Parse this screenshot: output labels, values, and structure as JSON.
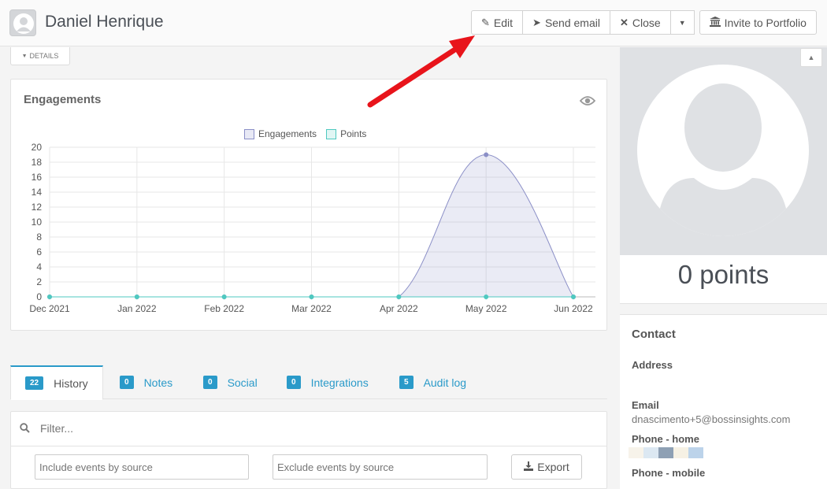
{
  "header": {
    "title": "Daniel Henrique",
    "buttons": {
      "edit": "Edit",
      "send_email": "Send email",
      "close": "Close",
      "invite": "Invite to Portfolio"
    }
  },
  "details_toggle": "DETAILS",
  "engagements": {
    "title": "Engagements",
    "legend": [
      "Engagements",
      "Points"
    ]
  },
  "chart_data": {
    "type": "area",
    "title": "Engagements",
    "x": [
      "Dec 2021",
      "Jan 2022",
      "Feb 2022",
      "Mar 2022",
      "Apr 2022",
      "May 2022",
      "Jun 2022"
    ],
    "series": [
      {
        "name": "Engagements",
        "values": [
          0,
          0,
          0,
          0,
          0,
          19,
          0
        ],
        "color": "#8b8fc7"
      },
      {
        "name": "Points",
        "values": [
          0,
          0,
          0,
          0,
          0,
          0,
          0
        ],
        "color": "#4fc9c0"
      }
    ],
    "yticks": [
      0,
      2,
      4,
      6,
      8,
      10,
      12,
      14,
      16,
      18,
      20
    ],
    "ylim": [
      0,
      20
    ],
    "grid": true,
    "legend_position": "top-center"
  },
  "tabs": [
    {
      "count": "22",
      "label": "History"
    },
    {
      "count": "0",
      "label": "Notes"
    },
    {
      "count": "0",
      "label": "Social"
    },
    {
      "count": "0",
      "label": "Integrations"
    },
    {
      "count": "5",
      "label": "Audit log"
    }
  ],
  "filter": {
    "placeholder": "Filter...",
    "include_placeholder": "Include events by source",
    "exclude_placeholder": "Exclude events by source",
    "export_label": "Export"
  },
  "sidebar": {
    "points": "0 points",
    "contact_heading": "Contact",
    "address_label": "Address",
    "email_label": "Email",
    "email_value": "dnascimento+5@bossinsights.com",
    "phone_home_label": "Phone - home",
    "phone_mobile_label": "Phone - mobile"
  },
  "colors": {
    "accent": "#2a9ac9",
    "annotation_arrow": "#e8141b"
  }
}
